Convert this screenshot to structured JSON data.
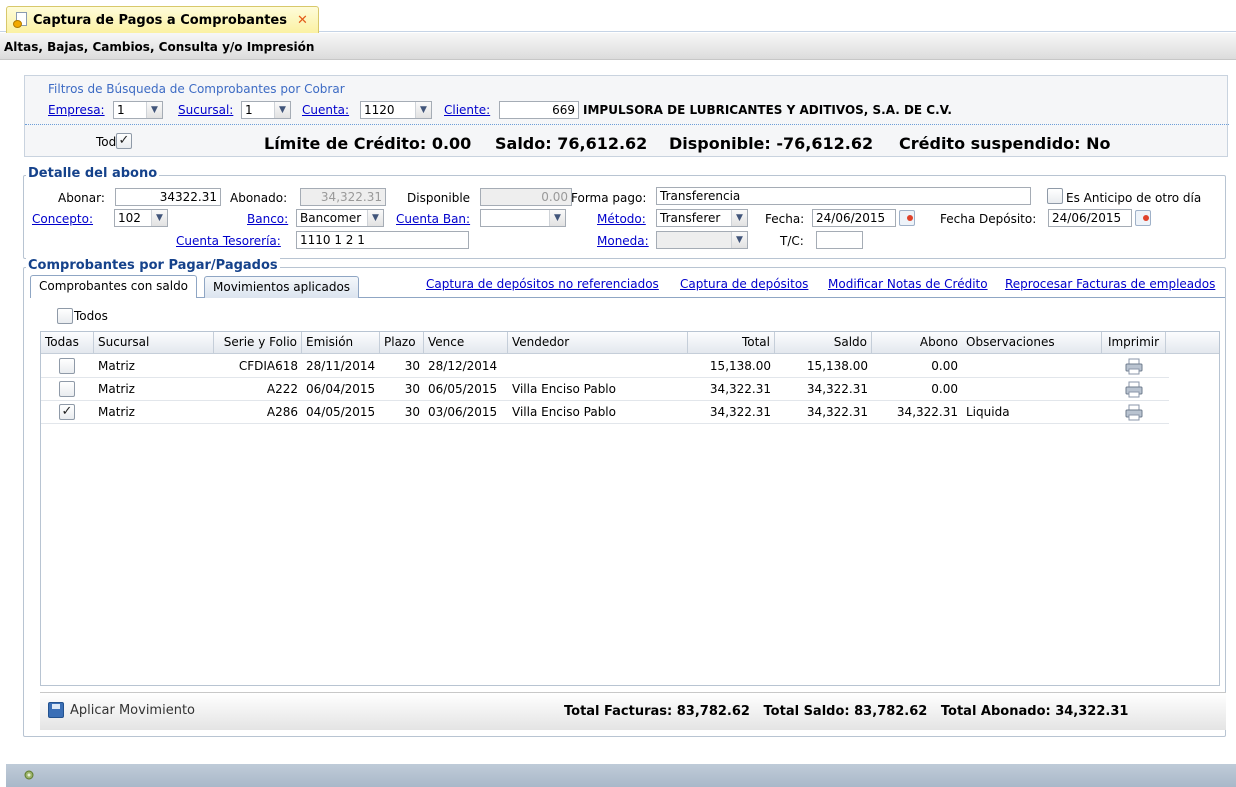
{
  "tab": {
    "title": "Captura de Pagos a Comprobantes",
    "close": "✕"
  },
  "subheader": "Altas, Bajas, Cambios, Consulta y/o Impresión",
  "filters": {
    "title": "Filtros de Búsqueda de Comprobantes por Cobrar",
    "empresa_label": "Empresa:",
    "empresa_value": "1",
    "sucursal_label": "Sucursal:",
    "sucursal_value": "1",
    "cuenta_label": "Cuenta:",
    "cuenta_value": "1120",
    "cliente_label": "Cliente:",
    "cliente_value": "669",
    "cliente_name": "IMPULSORA DE LUBRICANTES Y ADITIVOS, S.A. DE C.V.",
    "todo_label": "Todo:",
    "todo_checked": "✓",
    "limite": "Límite de Crédito: 0.00",
    "saldo": "Saldo: 76,612.62",
    "disponible": "Disponible: -76,612.62",
    "suspendido": "Crédito suspendido: No"
  },
  "detalle": {
    "legend": "Detalle del abono",
    "abonar_label": "Abonar:",
    "abonar_value": "34322.31",
    "abonado_label": "Abonado:",
    "abonado_value": "34,322.31",
    "disponible_label": "Disponible",
    "disponible_value": "0.00",
    "forma_pago_label": "Forma pago:",
    "forma_pago_value": "Transferencia",
    "anticipo_label": "Es Anticipo de otro día",
    "concepto_label": "Concepto:",
    "concepto_value": "102",
    "banco_label": "Banco:",
    "banco_value": "Bancomer",
    "cuenta_ban_label": "Cuenta Ban:",
    "cuenta_ban_value": "",
    "metodo_label": "Método:",
    "metodo_value": "Transferer",
    "fecha_label": "Fecha:",
    "fecha_value": "24/06/2015",
    "fecha_deposito_label": "Fecha Depósito:",
    "fecha_deposito_value": "24/06/2015",
    "cuenta_tesoreria_label": "Cuenta Tesorería:",
    "cuenta_tesoreria_value": "1110 1  2  1",
    "moneda_label": "Moneda:",
    "moneda_value": "",
    "tc_label": "T/C:",
    "tc_value": ""
  },
  "comprobantes": {
    "legend": "Comprobantes por Pagar/Pagados",
    "tabs": [
      "Comprobantes con saldo",
      "Movimientos aplicados"
    ],
    "links": [
      "Captura de depósitos no referenciados",
      "Captura de depósitos",
      "Modificar Notas de Crédito",
      "Reprocesar Facturas de empleados"
    ],
    "todos_label": "Todos",
    "columns": [
      "Todas",
      "Sucursal",
      "Serie y Folio",
      "Emisión",
      "Plazo",
      "Vence",
      "Vendedor",
      "Total",
      "Saldo",
      "Abono",
      "Observaciones",
      "Imprimir"
    ],
    "rows": [
      {
        "checked": "",
        "sucursal": "Matriz",
        "folio": "CFDIA618",
        "emision": "28/11/2014",
        "plazo": "30",
        "vence": "28/12/2014",
        "vendedor": "",
        "total": "15,138.00",
        "saldo": "15,138.00",
        "abono": "0.00",
        "observaciones": ""
      },
      {
        "checked": "",
        "sucursal": "Matriz",
        "folio": "A222",
        "emision": "06/04/2015",
        "plazo": "30",
        "vence": "06/05/2015",
        "vendedor": "Villa Enciso Pablo",
        "total": "34,322.31",
        "saldo": "34,322.31",
        "abono": "0.00",
        "observaciones": ""
      },
      {
        "checked": "✓",
        "sucursal": "Matriz",
        "folio": "A286",
        "emision": "04/05/2015",
        "plazo": "30",
        "vence": "03/06/2015",
        "vendedor": "Villa Enciso Pablo",
        "total": "34,322.31",
        "saldo": "34,322.31",
        "abono": "34,322.31",
        "observaciones": "Liquida"
      }
    ]
  },
  "bottom": {
    "apply_label": "Aplicar Movimiento",
    "totals": "Total Facturas: 83,782.62   Total Saldo: 83,782.62   Total Abonado: 34,322.31"
  }
}
